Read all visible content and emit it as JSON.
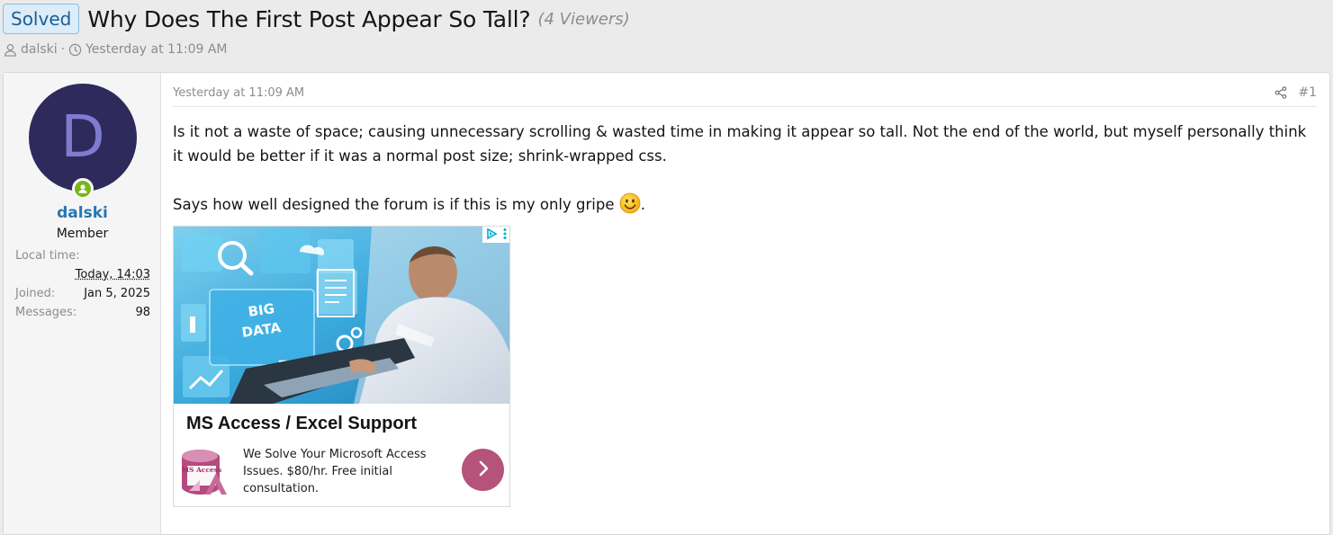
{
  "thread": {
    "prefix": "Solved",
    "title": "Why Does The First Post Appear So Tall?",
    "viewers": "(4 Viewers)",
    "author": "dalski",
    "separator": "·",
    "date": "Yesterday at 11:09 AM"
  },
  "post": {
    "date": "Yesterday at 11:09 AM",
    "number": "#1",
    "paragraph1": "Is it not a waste of space; causing unnecessary scrolling & wasted time in making it appear so tall. Not the end of the world, but myself personally think it would be better if it was a normal post size; shrink-wrapped css.",
    "paragraph2": "Says how well designed the forum is if this is my only gripe",
    "paragraph2_end": "."
  },
  "user": {
    "avatar_letter": "D",
    "name": "dalski",
    "title": "Member",
    "local_time_label": "Local time:",
    "local_time_value": "Today, 14:03",
    "joined_label": "Joined:",
    "joined_value": "Jan 5, 2025",
    "messages_label": "Messages:",
    "messages_value": "98"
  },
  "ad": {
    "image_text_line1": "BIG",
    "image_text_line2": "DATA",
    "title": "MS Access / Excel Support",
    "logo_text": "MS Access",
    "description": "We Solve Your Microsoft Access Issues. $80/hr. Free initial consultation."
  },
  "colors": {
    "link": "#2577b1",
    "badge_bg": "#dcecf8",
    "avatar_bg": "#2e2a5c",
    "online": "#7ab51d",
    "ad_button": "#b5537a"
  }
}
